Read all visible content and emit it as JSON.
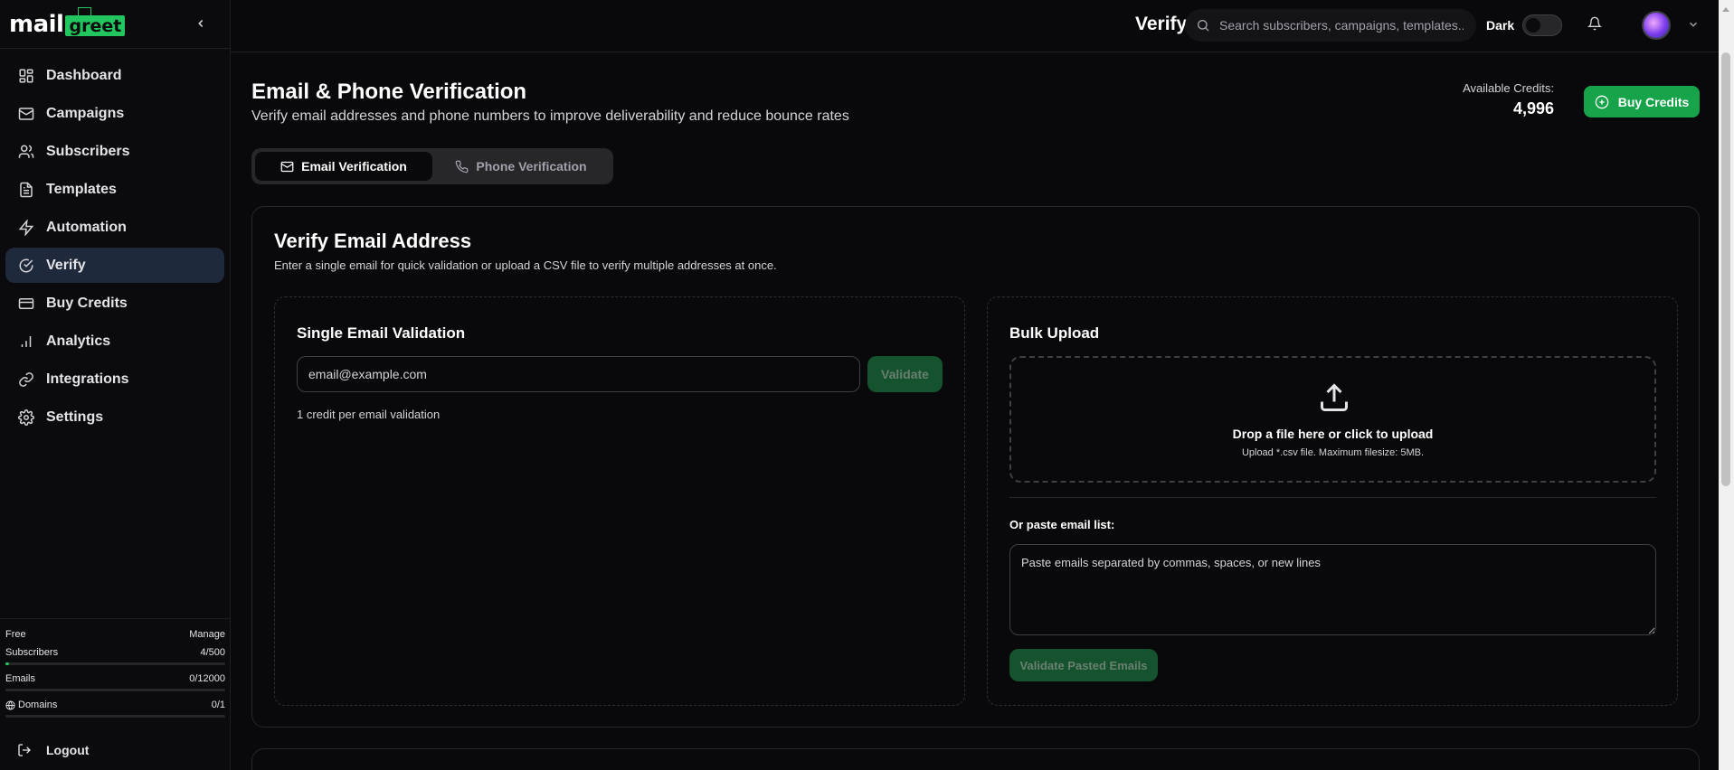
{
  "brand": {
    "logo_mail": "mail",
    "logo_greet": "greet"
  },
  "sidebar": {
    "items": [
      {
        "label": "Dashboard",
        "icon": "grid-icon"
      },
      {
        "label": "Campaigns",
        "icon": "mail-icon"
      },
      {
        "label": "Subscribers",
        "icon": "users-icon"
      },
      {
        "label": "Templates",
        "icon": "file-icon"
      },
      {
        "label": "Automation",
        "icon": "bolt-icon"
      },
      {
        "label": "Verify",
        "icon": "check-circle-icon",
        "active": true
      },
      {
        "label": "Buy Credits",
        "icon": "credit-card-icon"
      },
      {
        "label": "Analytics",
        "icon": "bar-chart-icon"
      },
      {
        "label": "Integrations",
        "icon": "link-icon"
      },
      {
        "label": "Settings",
        "icon": "gear-icon"
      }
    ],
    "plan": {
      "name": "Free",
      "manage": "Manage",
      "subscribers_label": "Subscribers",
      "subscribers_value": "4/500",
      "subscribers_fraction": 0.008,
      "emails_label": "Emails",
      "emails_value": "0/12000",
      "emails_fraction": 0,
      "domains_label": "Domains",
      "domains_value": "0/1",
      "domains_fraction": 0
    },
    "logout": "Logout"
  },
  "header": {
    "title": "Verify",
    "search_placeholder": "Search subscribers, campaigns, templates...",
    "theme_label": "Dark"
  },
  "page": {
    "title": "Email & Phone Verification",
    "subtitle": "Verify email addresses and phone numbers to improve deliverability and reduce bounce rates",
    "credits_label": "Available Credits:",
    "credits_value": "4,996",
    "buy_button": "Buy Credits",
    "tabs": [
      {
        "label": "Email Verification",
        "active": true
      },
      {
        "label": "Phone Verification",
        "active": false
      }
    ]
  },
  "verify_card": {
    "title": "Verify Email Address",
    "subtitle": "Enter a single email for quick validation or upload a CSV file to verify multiple addresses at once.",
    "single": {
      "title": "Single Email Validation",
      "placeholder": "email@example.com",
      "button": "Validate",
      "note": "1 credit per email validation"
    },
    "bulk": {
      "title": "Bulk Upload",
      "drop_title": "Drop a file here or click to upload",
      "drop_sub": "Upload *.csv file. Maximum filesize: 5MB.",
      "paste_label": "Or paste email list:",
      "paste_placeholder": "Paste emails separated by commas, spaces, or new lines",
      "paste_button": "Validate Pasted Emails"
    }
  },
  "colors": {
    "accent": "#16a34a",
    "active_nav": "#1e293b",
    "background": "#09090b"
  }
}
